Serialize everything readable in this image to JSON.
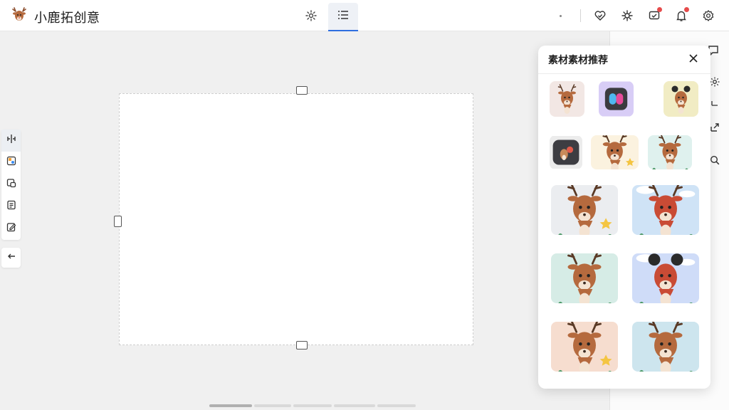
{
  "app": {
    "title": "小鹿拓创意"
  },
  "panel": {
    "title": "素材素材推荐"
  },
  "thumbnails": [
    {
      "style": "deer",
      "bg": "#f2e7e4"
    },
    {
      "style": "app-logo",
      "bg": "#d8cdf6"
    },
    {
      "style": "mouse-deer",
      "bg": "#f1ecc4"
    },
    {
      "style": "deer-dark",
      "bg": "#ececec"
    },
    {
      "style": "deer-stars",
      "bg": "#fbf2df"
    },
    {
      "style": "deer-plants",
      "bg": "#dff1ee"
    },
    {
      "style": "deer-star",
      "bg": "#ebedf0"
    },
    {
      "style": "deer-red-sky",
      "bg": "#cfe3f6"
    },
    {
      "style": "deer-mint",
      "bg": "#d6ece6"
    },
    {
      "style": "mouse-red-sky",
      "bg": "#cfdcf8"
    },
    {
      "style": "deer-peach",
      "bg": "#f6ddcf"
    },
    {
      "style": "deer-teal-face",
      "bg": "#cde5ee"
    }
  ],
  "colors": {
    "accent": "#2f6fe0",
    "badge": "#e64b4b",
    "deer_brown": "#b56a3e"
  }
}
